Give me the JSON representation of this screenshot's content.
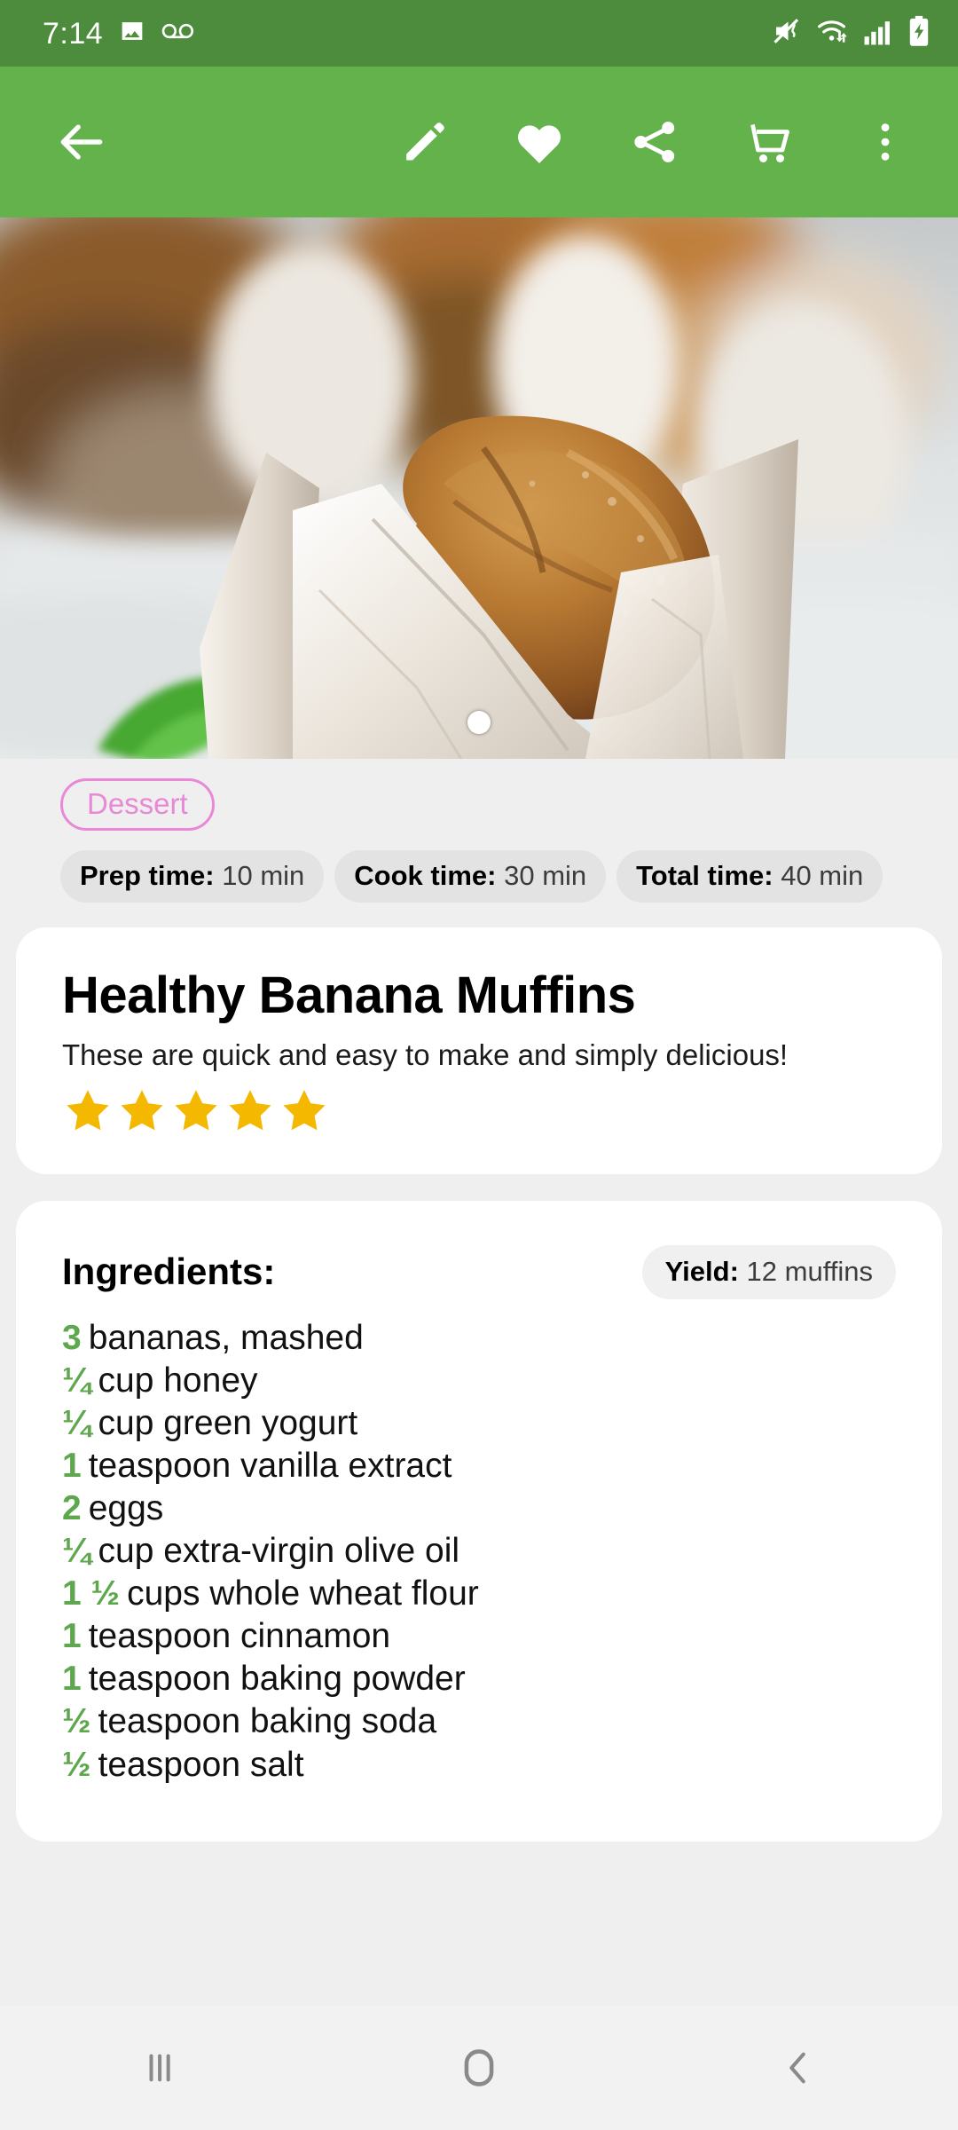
{
  "status_bar": {
    "time": "7:14",
    "left_icons": [
      "image-icon",
      "voicemail-icon"
    ],
    "right_icons": [
      "mute-vibrate-icon",
      "wifi-icon",
      "signal-bars-icon",
      "battery-charging-icon"
    ],
    "background_color": "#4c8c3c"
  },
  "toolbar": {
    "background_color": "#64b24b",
    "back_label": "Back",
    "edit_label": "Edit",
    "favorite_label": "Favorite",
    "share_label": "Share",
    "cart_label": "Shopping list",
    "overflow_label": "More options"
  },
  "hero": {
    "alt": "Banana muffin in parchment wrapper",
    "carousel_index": "1"
  },
  "meta": {
    "category": "Dessert",
    "category_color": "#e888d6",
    "times": [
      {
        "label": "Prep time:",
        "value": "10 min"
      },
      {
        "label": "Cook time:",
        "value": "30 min"
      },
      {
        "label": "Total time:",
        "value": "40 min"
      }
    ]
  },
  "recipe": {
    "title": "Healthy Banana Muffins",
    "description": "These are quick and easy to make and simply delicious!",
    "rating": 5,
    "star_color": "#f5b800"
  },
  "ingredients_section": {
    "heading": "Ingredients:",
    "yield_label": "Yield:",
    "yield_value": "12 muffins",
    "accent_color": "#5da84d",
    "items": [
      {
        "qty": "3",
        "text": "bananas, mashed"
      },
      {
        "qty": "¼",
        "text": "cup honey"
      },
      {
        "qty": "¼",
        "text": "cup green yogurt"
      },
      {
        "qty": "1",
        "text": "teaspoon vanilla extract"
      },
      {
        "qty": "2",
        "text": "eggs"
      },
      {
        "qty": "¼",
        "text": "cup extra-virgin olive oil"
      },
      {
        "qty": "1 ½",
        "text": "cups whole wheat flour"
      },
      {
        "qty": "1",
        "text": "teaspoon cinnamon"
      },
      {
        "qty": "1",
        "text": "teaspoon baking powder"
      },
      {
        "qty": "½",
        "text": "teaspoon baking soda"
      },
      {
        "qty": "½",
        "text": "teaspoon salt"
      }
    ]
  },
  "navbar": {
    "recents_label": "Recents",
    "home_label": "Home",
    "back_label": "Back"
  }
}
